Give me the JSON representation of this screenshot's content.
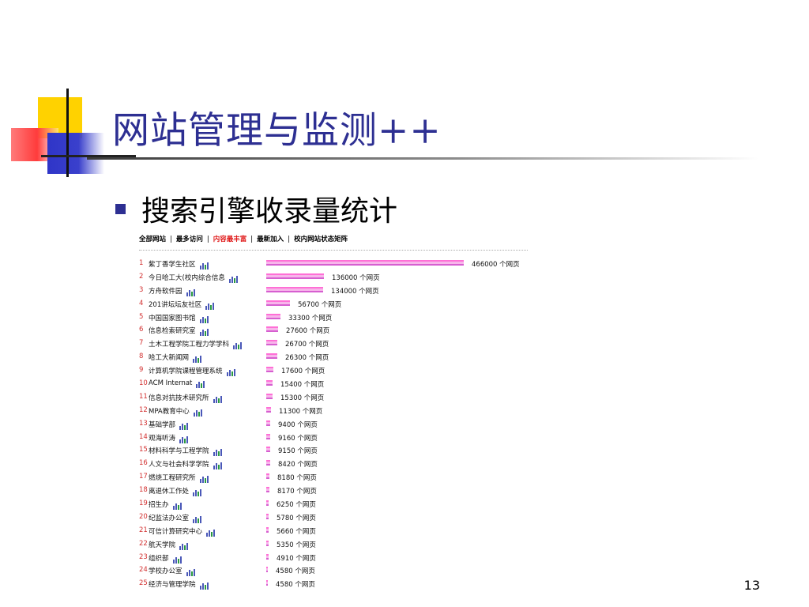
{
  "slide": {
    "title": "网站管理与监测++",
    "bullet": "搜索引擎收录量统计",
    "page_number": "13"
  },
  "nav": {
    "items": [
      "全部网站",
      "最多访问",
      "内容最丰富",
      "最新加入",
      "校内网站状态矩阵"
    ],
    "active_index": 2,
    "separator": "|"
  },
  "colors": {
    "title": "#2d2f92",
    "bar": "#f7b6ea",
    "bar_edge": "#ff6fd6",
    "rank": "#d23030",
    "nav_active": "#e01b1b"
  },
  "unit": "个网页",
  "icon_name": "bar-chart-icon",
  "sites": [
    {
      "rank": "1",
      "name": "紫丁香学生社区",
      "value": 466000
    },
    {
      "rank": "2",
      "name": "今日哈工大(校内综合信息",
      "value": 136000
    },
    {
      "rank": "3",
      "name": "方舟软件园",
      "value": 134000
    },
    {
      "rank": "4",
      "name": "201讲坛坛友社区",
      "value": 56700
    },
    {
      "rank": "5",
      "name": "中国国家图书馆",
      "value": 33300
    },
    {
      "rank": "6",
      "name": "信息检索研究室",
      "value": 27600
    },
    {
      "rank": "7",
      "name": "土木工程学院工程力学学科",
      "value": 26700
    },
    {
      "rank": "8",
      "name": "哈工大新闻网",
      "value": 26300
    },
    {
      "rank": "9",
      "name": "计算机学院课程管理系统",
      "value": 17600
    },
    {
      "rank": "10",
      "name": "ACM Internat",
      "value": 15400
    },
    {
      "rank": "11",
      "name": "信息对抗技术研究所",
      "value": 15300
    },
    {
      "rank": "12",
      "name": "MPA教育中心",
      "value": 11300
    },
    {
      "rank": "13",
      "name": "基础学部",
      "value": 9400
    },
    {
      "rank": "14",
      "name": "观海听涛",
      "value": 9160
    },
    {
      "rank": "15",
      "name": "材料科学与工程学院",
      "value": 9150
    },
    {
      "rank": "16",
      "name": "人文与社会科学学院",
      "value": 8420
    },
    {
      "rank": "17",
      "name": "燃烧工程研究所",
      "value": 8180
    },
    {
      "rank": "18",
      "name": "离退休工作处",
      "value": 8170
    },
    {
      "rank": "19",
      "name": "招生办",
      "value": 6250
    },
    {
      "rank": "20",
      "name": "纪监法办公室",
      "value": 5780
    },
    {
      "rank": "21",
      "name": "可信计算研究中心",
      "value": 5660
    },
    {
      "rank": "22",
      "name": "航天学院",
      "value": 5350
    },
    {
      "rank": "23",
      "name": "组织部",
      "value": 4910
    },
    {
      "rank": "24",
      "name": "学校办公室",
      "value": 4580
    },
    {
      "rank": "25",
      "name": "经济与管理学院",
      "value": 4580
    }
  ]
}
